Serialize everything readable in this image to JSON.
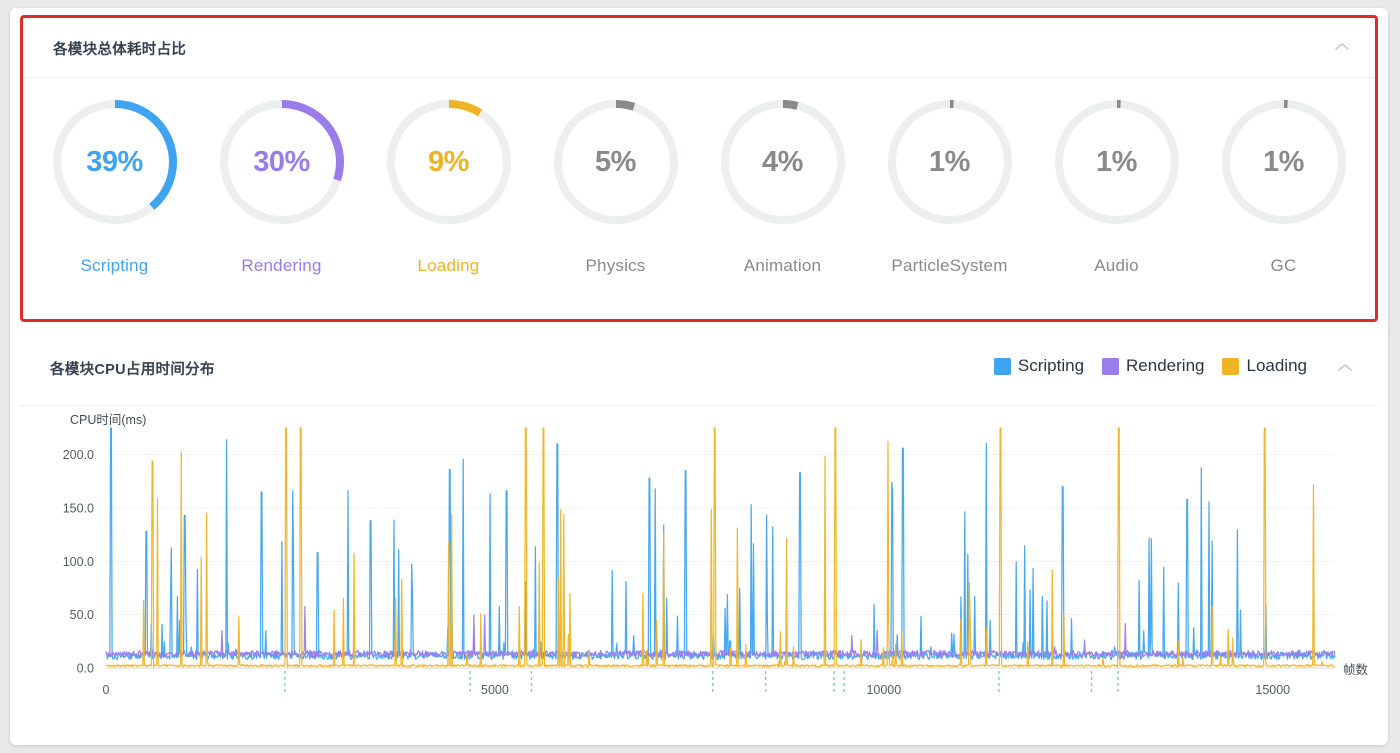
{
  "panels": [
    {
      "id": "module-time-share",
      "title": "各模块总体耗时占比",
      "collapse_icon": "chevron-up-icon",
      "highlighted": true,
      "highlight_color": "#e22b2b"
    },
    {
      "id": "module-cpu-distribution",
      "title": "各模块CPU占用时间分布",
      "collapse_icon": "chevron-up-icon",
      "highlighted": false
    }
  ],
  "donuts": [
    {
      "label": "Scripting",
      "value": 39,
      "text": "39%",
      "color": "#3fa4ef",
      "track": "#ecefee"
    },
    {
      "label": "Rendering",
      "value": 30,
      "text": "30%",
      "color": "#9b7ceb",
      "track": "#ecefee"
    },
    {
      "label": "Loading",
      "value": 9,
      "text": "9%",
      "color": "#efb423",
      "track": "#ecefee"
    },
    {
      "label": "Physics",
      "value": 5,
      "text": "5%",
      "color": "#8a8a8a",
      "track": "#ecefee"
    },
    {
      "label": "Animation",
      "value": 4,
      "text": "4%",
      "color": "#8a8a8a",
      "track": "#ecefee"
    },
    {
      "label": "ParticleSystem",
      "value": 1,
      "text": "1%",
      "color": "#8a8a8a",
      "track": "#ecefee"
    },
    {
      "label": "Audio",
      "value": 1,
      "text": "1%",
      "color": "#8a8a8a",
      "track": "#ecefee"
    },
    {
      "label": "GC",
      "value": 1,
      "text": "1%",
      "color": "#8a8a8a",
      "track": "#ecefee"
    }
  ],
  "legend": [
    {
      "label": "Scripting",
      "color": "#3fa4ef"
    },
    {
      "label": "Rendering",
      "color": "#9b7ceb"
    },
    {
      "label": "Loading",
      "color": "#efb423"
    }
  ],
  "chart_data": {
    "type": "line",
    "title": "各模块CPU占用时间分布",
    "xlabel": "帧数",
    "ylabel": "CPU时间(ms)",
    "xlim": [
      0,
      15800
    ],
    "ylim": [
      0,
      225
    ],
    "xticks": [
      0,
      5000,
      10000,
      15000
    ],
    "xtick_labels": [
      "0",
      "5000",
      "10000",
      "15000"
    ],
    "yticks": [
      0,
      50,
      100,
      150,
      200
    ],
    "ytick_labels": [
      "0.0",
      "50.0",
      "100.0",
      "150.0",
      "200.0"
    ],
    "grid": true,
    "grid_axis": "y",
    "legend_position": "top-right",
    "series": [
      {
        "name": "Scripting",
        "color": "#3fa4ef",
        "baseline": 11,
        "noise": 7,
        "spike_rate": 0.055,
        "spike_max": 225
      },
      {
        "name": "Rendering",
        "color": "#9b7ceb",
        "baseline": 13,
        "noise": 6,
        "spike_rate": 0.012,
        "spike_max": 95
      },
      {
        "name": "Loading",
        "color": "#efb423",
        "baseline": 2,
        "noise": 2,
        "spike_rate": 0.03,
        "spike_max": 235
      }
    ],
    "marker_lines": {
      "color": "#5ec9b4",
      "style": "dashed",
      "x_values": [
        2300,
        4680,
        5470,
        7800,
        8480,
        9360,
        9490,
        11480,
        12670,
        13010
      ]
    },
    "notable_spikes": {
      "Scripting": [
        {
          "x": 60,
          "y": 225
        },
        {
          "x": 520,
          "y": 128
        },
        {
          "x": 1010,
          "y": 143
        },
        {
          "x": 2000,
          "y": 165
        },
        {
          "x": 2720,
          "y": 108
        },
        {
          "x": 3400,
          "y": 138
        },
        {
          "x": 4420,
          "y": 186
        },
        {
          "x": 5150,
          "y": 166
        },
        {
          "x": 5800,
          "y": 210
        },
        {
          "x": 6990,
          "y": 178
        },
        {
          "x": 7450,
          "y": 185
        },
        {
          "x": 8920,
          "y": 183
        },
        {
          "x": 10250,
          "y": 206
        },
        {
          "x": 12300,
          "y": 170
        },
        {
          "x": 13900,
          "y": 158
        }
      ],
      "Loading": [
        {
          "x": 600,
          "y": 194
        },
        {
          "x": 2320,
          "y": 225
        },
        {
          "x": 2500,
          "y": 225
        },
        {
          "x": 5400,
          "y": 225
        },
        {
          "x": 5620,
          "y": 225
        },
        {
          "x": 7830,
          "y": 225
        },
        {
          "x": 9380,
          "y": 225
        },
        {
          "x": 11500,
          "y": 225
        },
        {
          "x": 13020,
          "y": 225
        },
        {
          "x": 14900,
          "y": 225
        }
      ]
    }
  }
}
